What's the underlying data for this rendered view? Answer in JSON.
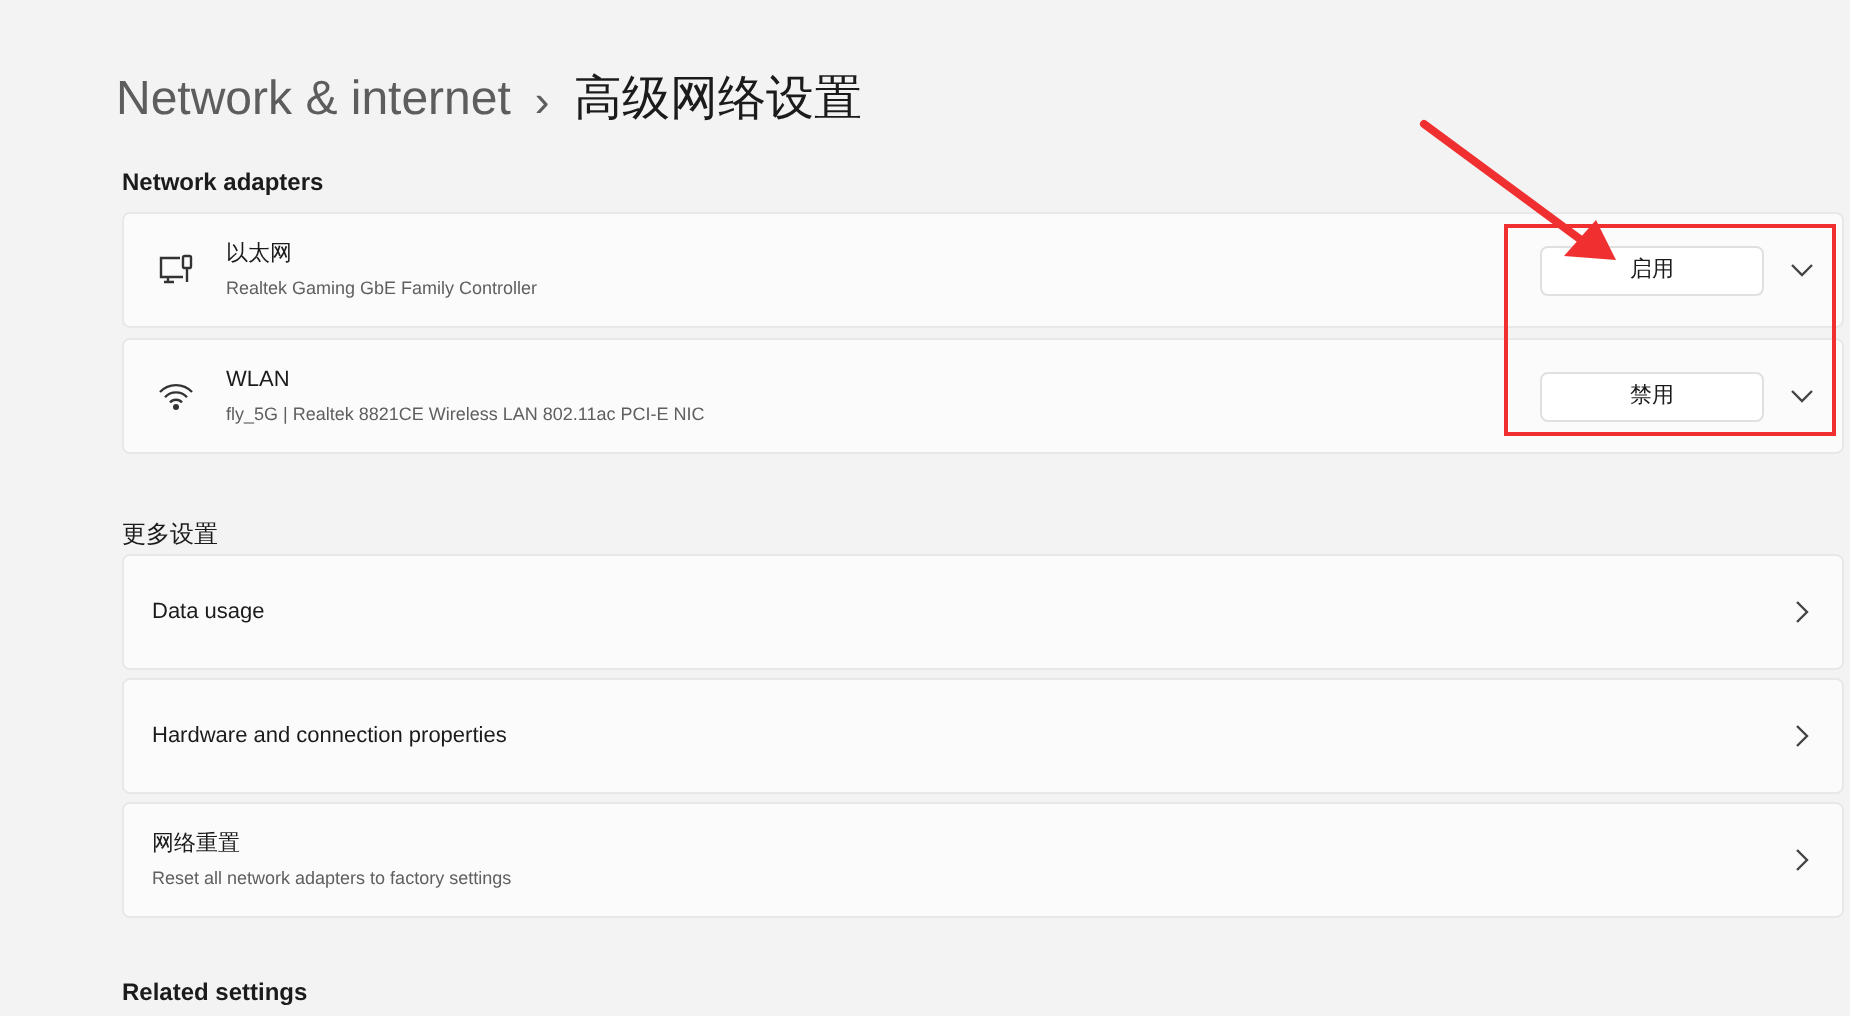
{
  "breadcrumb": {
    "parent": "Network & internet",
    "separator": "›",
    "current": "高级网络设置"
  },
  "network_adapters": {
    "title": "Network adapters",
    "items": [
      {
        "kind": "ethernet",
        "name": "以太网",
        "description": "Realtek Gaming GbE Family Controller",
        "button": "启用"
      },
      {
        "kind": "wifi",
        "name": "WLAN",
        "description": "fly_5G | Realtek 8821CE Wireless LAN 802.11ac PCI-E NIC",
        "button": "禁用"
      }
    ]
  },
  "more_settings": {
    "title": "更多设置",
    "items": [
      {
        "label": "Data usage"
      },
      {
        "label": "Hardware and connection properties"
      },
      {
        "label": "网络重置",
        "description": "Reset all network adapters to factory settings"
      }
    ]
  },
  "related_settings": {
    "title": "Related settings"
  }
}
